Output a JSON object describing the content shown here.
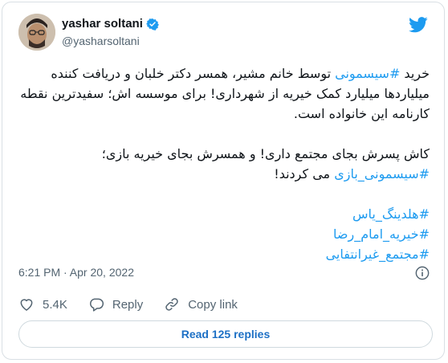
{
  "author": {
    "name": "yashar soltani",
    "handle": "@yasharsoltani",
    "verified": true
  },
  "tweet": {
    "p1": [
      {
        "t": "خرید "
      },
      {
        "t": "#سیسمونی",
        "tag": true
      },
      {
        "t": " توسط خانم مشیر، همسر دکتر خلبان و دریافت کننده میلیاردها میلیارد کمک خیریه از شهرداری! برای موسسه اش؛ سفیدترین نقطه کارنامه این خانواده است."
      }
    ],
    "p2": [
      {
        "t": "کاش پسرش بجای مجتمع داری! و همسرش بجای خیریه بازی؛ "
      },
      {
        "t": "#سیسمونی_بازی",
        "tag": true
      },
      {
        "t": " می کردند!"
      }
    ],
    "hashtags": [
      "#هلدینگ_یاس",
      "#خیریه_امام_رضا",
      "#مجتمع_غیرانتفایی"
    ]
  },
  "timestamp": "6:21 PM · Apr 20, 2022",
  "actions": {
    "likes": "5.4K",
    "reply": "Reply",
    "copy": "Copy link"
  },
  "read_replies": "Read 125 replies",
  "colors": {
    "accent": "#1d9bf0",
    "text": "#0f1419",
    "muted": "#536471"
  },
  "icons": [
    "twitter-bird-icon",
    "verified-badge-icon",
    "info-icon",
    "heart-icon",
    "reply-icon",
    "link-icon"
  ]
}
